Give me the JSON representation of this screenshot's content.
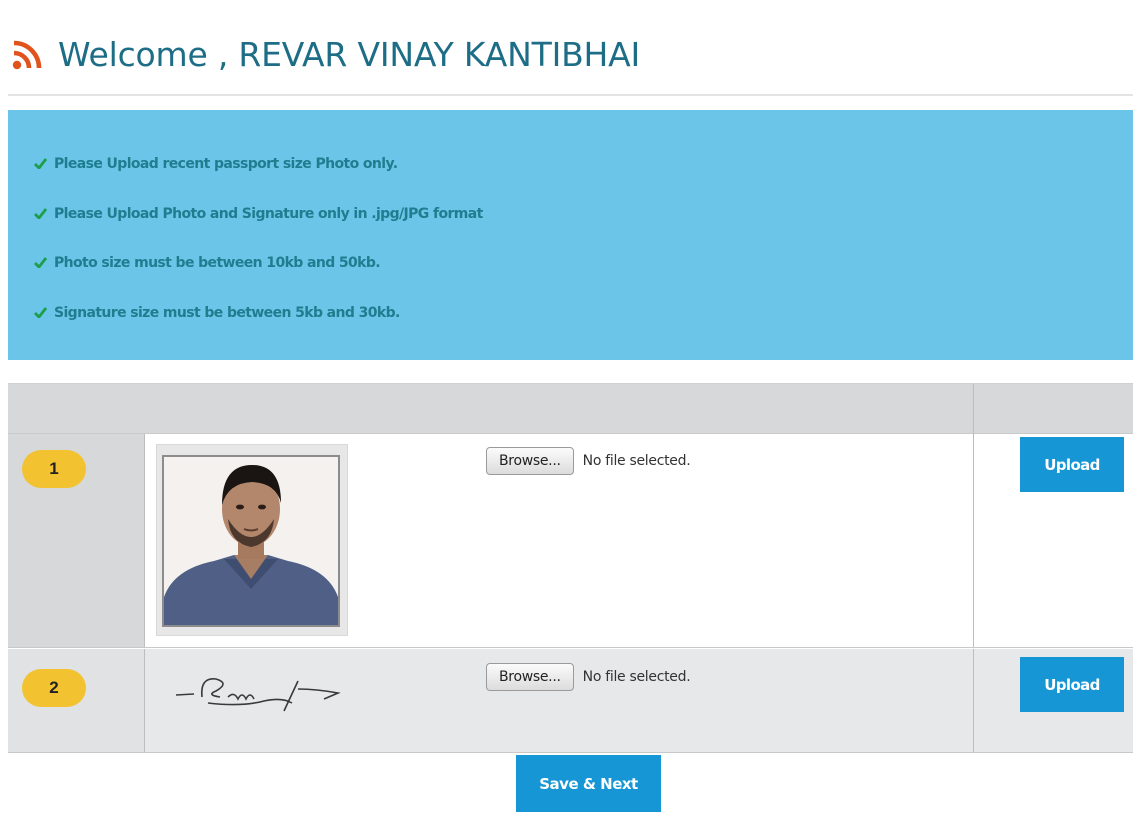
{
  "header": {
    "title": "Welcome , REVAR VINAY KANTIBHAI"
  },
  "instructions": [
    "Please Upload recent passport size Photo only.",
    "Please Upload Photo and Signature only in .jpg/JPG format",
    "Photo size must be between 10kb and 50kb.",
    "Signature size must be between 5kb and 30kb."
  ],
  "rows": [
    {
      "number": "1",
      "browse_label": "Browse...",
      "file_status": "No file selected.",
      "upload_label": "Upload"
    },
    {
      "number": "2",
      "browse_label": "Browse...",
      "file_status": "No file selected.",
      "upload_label": "Upload"
    }
  ],
  "footer": {
    "save_label": "Save & Next"
  },
  "colors": {
    "title": "#1d6d86",
    "rss_icon": "#e0531c",
    "info_bg": "#6bc5e8",
    "instruction_text": "#1f7d8f",
    "badge": "#f2c230",
    "button": "#1696d4"
  },
  "icons": {
    "header": "rss-icon",
    "instruction": "check-icon"
  }
}
